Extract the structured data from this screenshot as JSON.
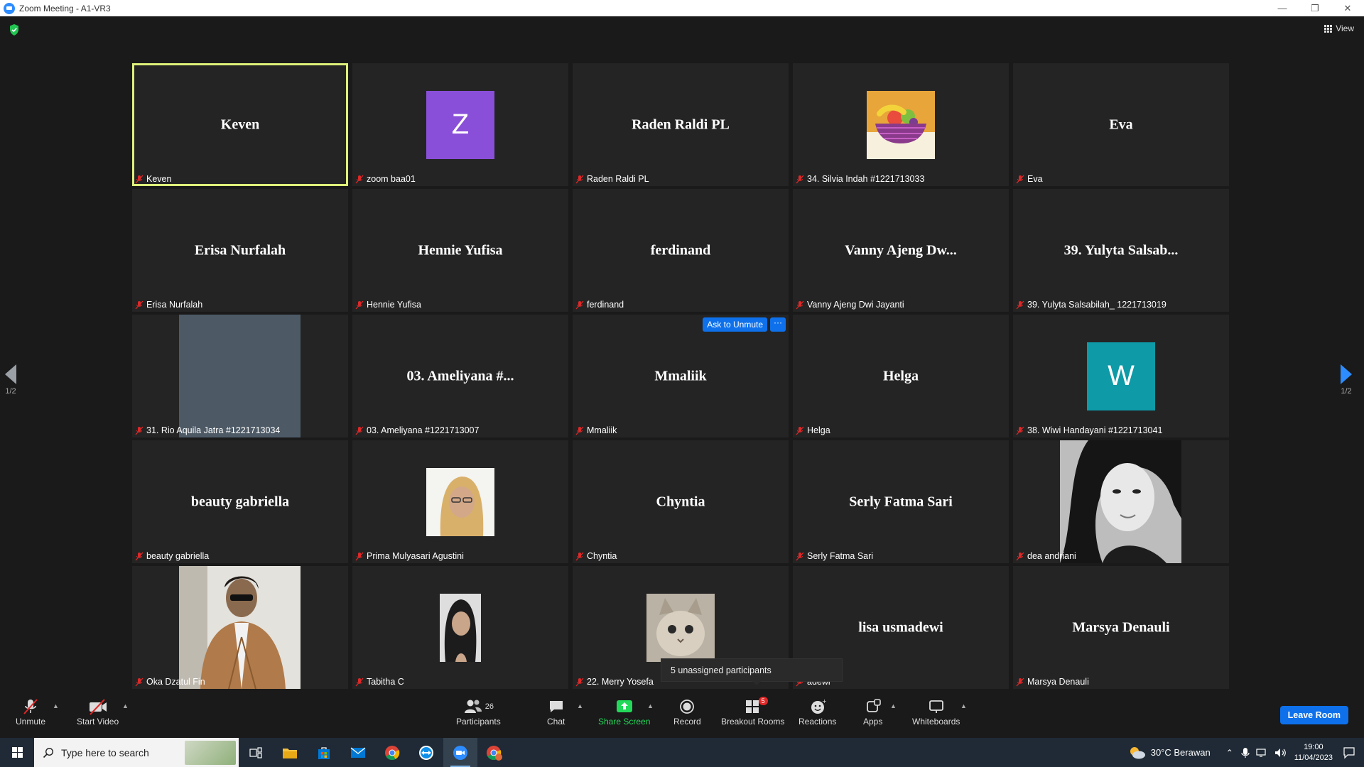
{
  "window": {
    "title": "Zoom Meeting - A1-VR3",
    "controls": [
      "—",
      "❐",
      "✕"
    ]
  },
  "view_label": "View",
  "tiles": [
    {
      "name": "Keven",
      "big": "Keven",
      "type": "name",
      "active": true
    },
    {
      "name": "zoom baa01",
      "type": "avatar",
      "letter": "Z",
      "color": "#8a4fd8"
    },
    {
      "name": "Raden Raldi PL",
      "big": "Raden Raldi PL",
      "type": "name"
    },
    {
      "name": "34. Silvia Indah #1221713033",
      "type": "fruit"
    },
    {
      "name": "Eva",
      "big": "Eva",
      "type": "name"
    },
    {
      "name": "Erisa Nurfalah",
      "big": "Erisa Nurfalah",
      "type": "name"
    },
    {
      "name": "Hennie Yufisa",
      "big": "Hennie Yufisa",
      "type": "name"
    },
    {
      "name": "ferdinand",
      "big": "ferdinand",
      "type": "name"
    },
    {
      "name": "Vanny Ajeng Dwi Jayanti",
      "big": "Vanny Ajeng Dw...",
      "type": "name"
    },
    {
      "name": "39. Yulyta Salsabilah_ 1221713019",
      "big": "39. Yulyta Salsab...",
      "type": "name"
    },
    {
      "name": "31. Rio Aquila Jatra #1221713034",
      "type": "video-gray"
    },
    {
      "name": "03. Ameliyana #1221713007",
      "big": "03. Ameliyana #...",
      "type": "name"
    },
    {
      "name": "Mmaliik",
      "big": "Mmaliik",
      "type": "name",
      "ask_unmute": true
    },
    {
      "name": "Helga",
      "big": "Helga",
      "type": "name"
    },
    {
      "name": "38. Wiwi Handayani #1221713041",
      "type": "avatar",
      "letter": "W",
      "color": "#0e9aa7"
    },
    {
      "name": "beauty gabriella",
      "big": "beauty gabriella",
      "type": "name"
    },
    {
      "name": "Prima Mulyasari Agustini",
      "type": "photo-small",
      "photo": "hijab"
    },
    {
      "name": "Chyntia",
      "big": "Chyntia",
      "type": "name"
    },
    {
      "name": "Serly Fatma Sari",
      "big": "Serly Fatma Sari",
      "type": "name"
    },
    {
      "name": "dea andriani",
      "type": "video-photo",
      "photo": "woman-bw"
    },
    {
      "name": "Oka Dzatul Fin",
      "type": "video-photo",
      "photo": "man-jacket"
    },
    {
      "name": "Tabitha C",
      "type": "photo-small",
      "photo": "woman-portrait"
    },
    {
      "name": "22. Merry Yosefa",
      "type": "photo-small",
      "photo": "cat"
    },
    {
      "name": "lisa usmadewi",
      "big": "lisa usmadewi",
      "type": "name",
      "label_shown": "adewi"
    },
    {
      "name": "Marsya Denauli",
      "big": "Marsya Denauli",
      "type": "name"
    }
  ],
  "ask_unmute_label": "Ask to Unmute",
  "ask_more_label": "···",
  "page_indicator": "1/2",
  "tooltip": "5 unassigned participants",
  "toolbar": {
    "unmute": "Unmute",
    "start_video": "Start Video",
    "participants": "Participants",
    "participants_count": "26",
    "chat": "Chat",
    "share_screen": "Share Screen",
    "record": "Record",
    "breakout_rooms": "Breakout Rooms",
    "breakout_badge": "5",
    "reactions": "Reactions",
    "apps": "Apps",
    "whiteboards": "Whiteboards",
    "leave_room": "Leave Room"
  },
  "taskbar": {
    "search_placeholder": "Type here to search",
    "weather": "30°C  Berawan",
    "time": "19:00",
    "date": "11/04/2023"
  },
  "colors": {
    "accent": "#0e71eb",
    "active_border": "#dff07a",
    "share_green": "#23d959",
    "muted_red": "#e02828"
  }
}
